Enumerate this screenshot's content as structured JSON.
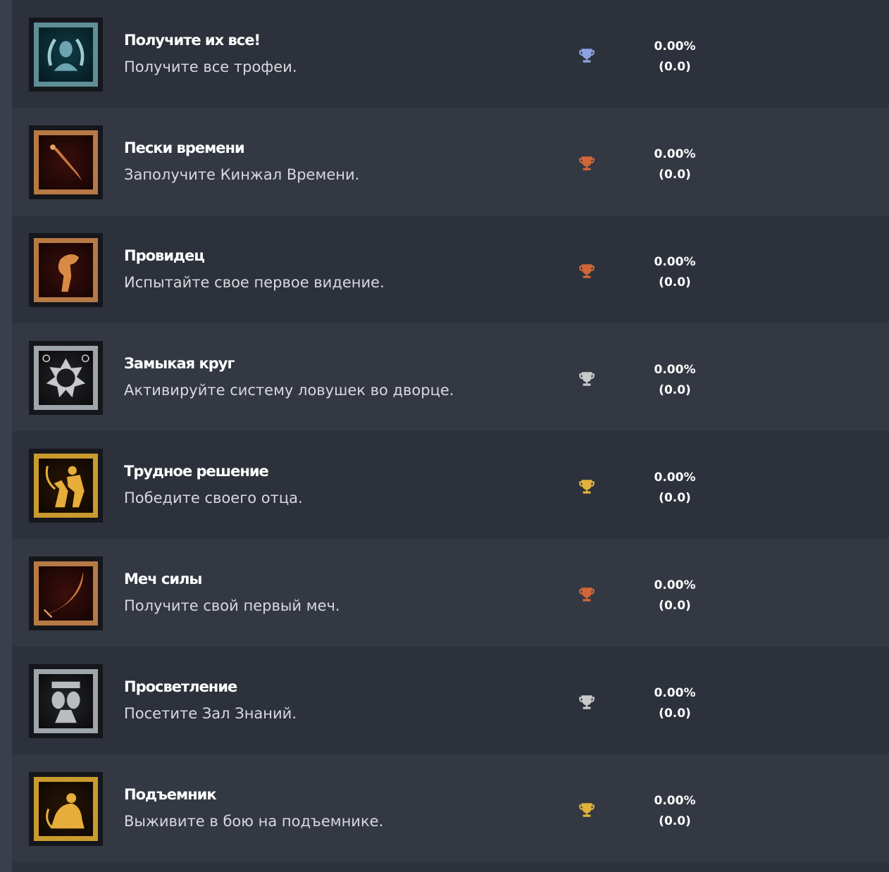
{
  "trophy_list": {
    "colors": {
      "platinum": "#8da3e0",
      "gold": "#e0b13c",
      "silver": "#c9c9c9",
      "bronze": "#d0673a"
    },
    "items": [
      {
        "name": "Получите их все!",
        "description": "Получите все трофеи.",
        "grade": "platinum",
        "icon": "laurel-bust-icon",
        "percent": "0.00%",
        "score": "(0.0)"
      },
      {
        "name": "Пески времени",
        "description": "Заполучите Кинжал Времени.",
        "grade": "bronze",
        "icon": "dagger-icon",
        "percent": "0.00%",
        "score": "(0.0)"
      },
      {
        "name": "Провидец",
        "description": "Испытайте свое первое видение.",
        "grade": "bronze",
        "icon": "hunched-figure-icon",
        "percent": "0.00%",
        "score": "(0.0)"
      },
      {
        "name": "Замыкая круг",
        "description": "Активируйте систему ловушек во дворце.",
        "grade": "silver",
        "icon": "gear-medallion-icon",
        "percent": "0.00%",
        "score": "(0.0)"
      },
      {
        "name": "Трудное решение",
        "description": "Победите своего отца.",
        "grade": "gold",
        "icon": "duel-figures-icon",
        "percent": "0.00%",
        "score": "(0.0)"
      },
      {
        "name": "Меч силы",
        "description": "Получите свой первый меч.",
        "grade": "bronze",
        "icon": "scimitar-icon",
        "percent": "0.00%",
        "score": "(0.0)"
      },
      {
        "name": "Просветление",
        "description": "Посетите Зал Знаний.",
        "grade": "silver",
        "icon": "statue-faces-icon",
        "percent": "0.00%",
        "score": "(0.0)"
      },
      {
        "name": "Подъемник",
        "description": "Выживите в бою на подъемнике.",
        "grade": "gold",
        "icon": "kneeling-figure-icon",
        "percent": "0.00%",
        "score": "(0.0)"
      }
    ]
  }
}
